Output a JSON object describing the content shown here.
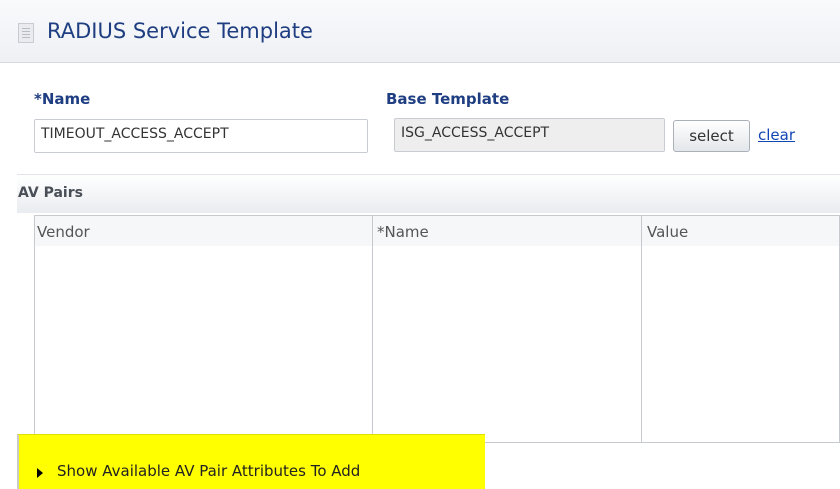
{
  "header": {
    "title": "RADIUS Service Template",
    "icon": "document-icon"
  },
  "form": {
    "name_label": "*Name",
    "name_value": "TIMEOUT_ACCESS_ACCEPT",
    "base_template_label": "Base Template",
    "base_template_value": "ISG_ACCESS_ACCEPT",
    "select_label": "select",
    "clear_label": "clear"
  },
  "av_pairs": {
    "title": "AV Pairs",
    "columns": [
      "Vendor",
      "*Name",
      "Value"
    ],
    "rows": []
  },
  "footer": {
    "toggle_label": "Show Available AV Pair Attributes To Add",
    "icon": "triangle-right-icon",
    "highlight_color": "#ffff00"
  },
  "colors": {
    "accent": "#1f3e82",
    "link": "#1046b4"
  }
}
